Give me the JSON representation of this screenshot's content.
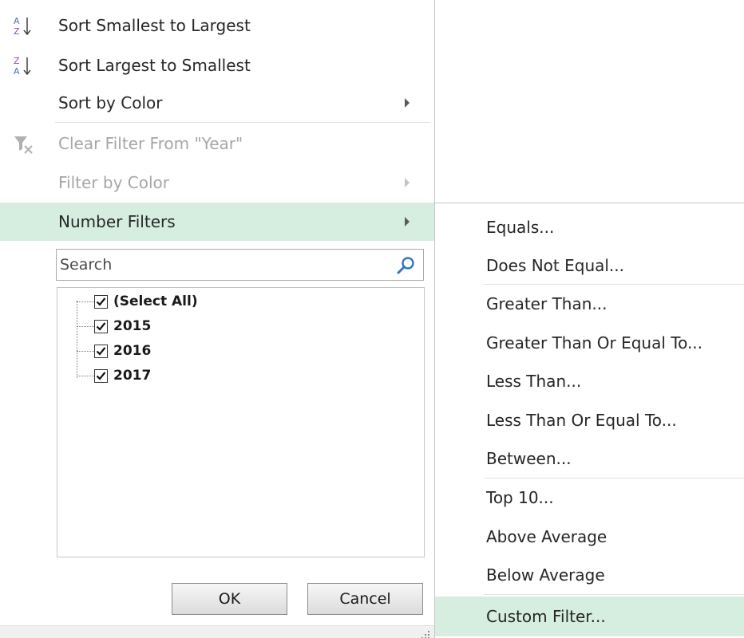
{
  "filter_menu": {
    "sort_asc": "Sort Smallest to Largest",
    "sort_desc": "Sort Largest to Smallest",
    "sort_by_color": "Sort by Color",
    "clear_filter": "Clear Filter From \"Year\"",
    "filter_by_color": "Filter by Color",
    "number_filters": "Number Filters",
    "search_placeholder": "Search",
    "values": [
      {
        "label": "(Select All)",
        "checked": true
      },
      {
        "label": "2015",
        "checked": true
      },
      {
        "label": "2016",
        "checked": true
      },
      {
        "label": "2017",
        "checked": true
      }
    ],
    "ok_label": "OK",
    "cancel_label": "Cancel"
  },
  "number_filters_submenu": {
    "items": [
      {
        "label": "Equals..."
      },
      {
        "label": "Does Not Equal..."
      },
      {
        "label": "Greater Than..."
      },
      {
        "label": "Greater Than Or Equal To..."
      },
      {
        "label": "Less Than..."
      },
      {
        "label": "Less Than Or Equal To..."
      },
      {
        "label": "Between..."
      },
      {
        "label": "Top 10..."
      },
      {
        "label": "Above Average"
      },
      {
        "label": "Below Average"
      },
      {
        "label": "Custom Filter..."
      }
    ],
    "highlighted": "Custom Filter..."
  },
  "colors": {
    "highlight": "#d6eee0",
    "sort_icon_blue": "#4a6fb5",
    "sort_icon_purple": "#8a4fb0",
    "search_icon": "#3a73b8"
  }
}
